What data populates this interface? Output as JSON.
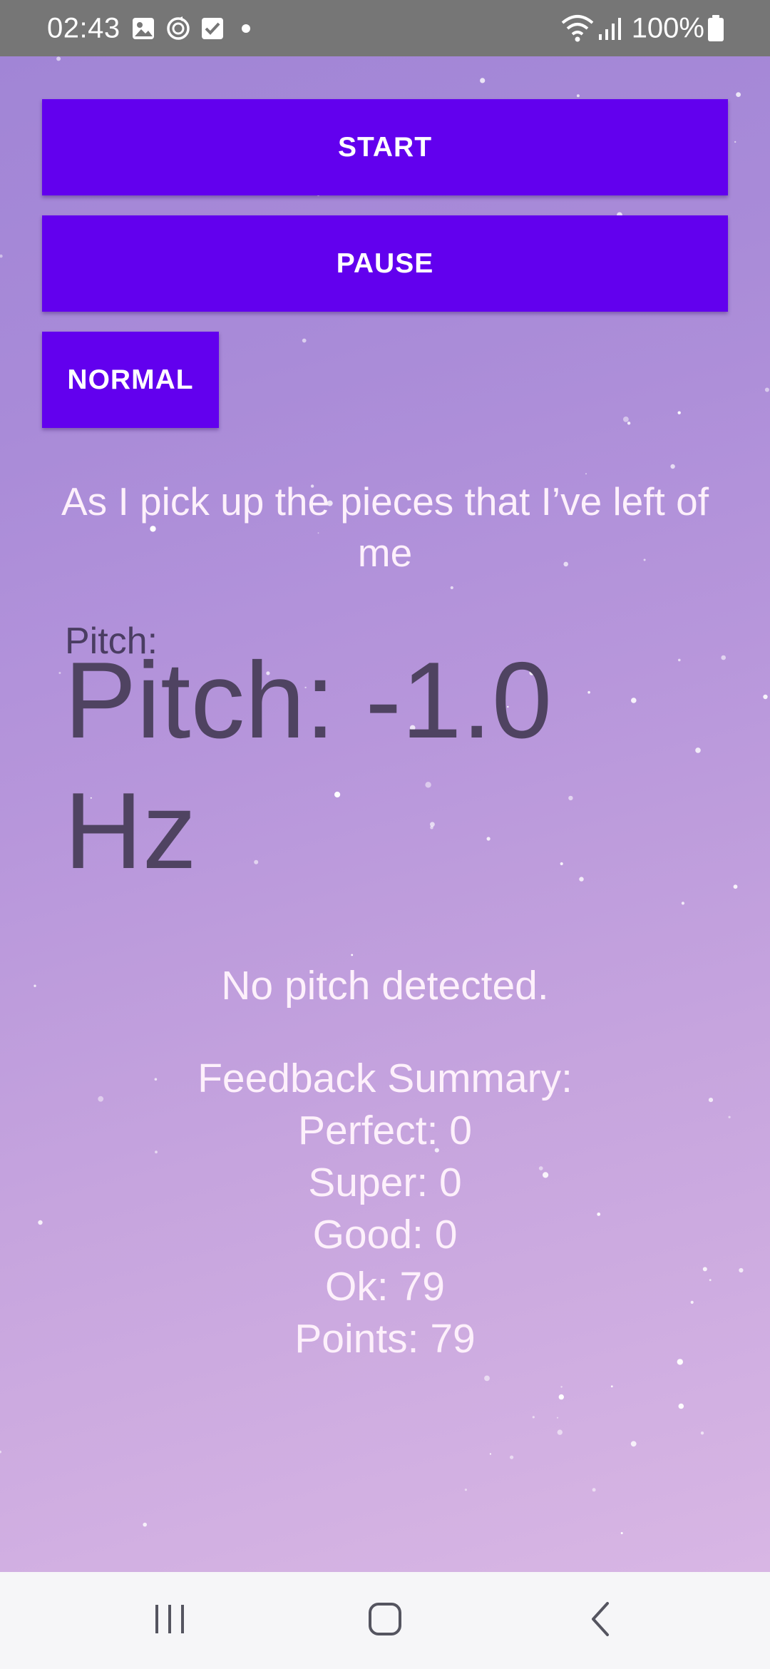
{
  "status_bar": {
    "time": "02:43",
    "battery_text": "100%",
    "icons": [
      "image-icon",
      "sync-icon",
      "checkbox-icon",
      "dot-icon",
      "wifi-icon",
      "signal-icon",
      "battery-icon"
    ]
  },
  "controls": {
    "start_label": "START",
    "pause_label": "PAUSE",
    "normal_label": "NORMAL"
  },
  "lyric": {
    "line": "As I pick up the pieces that I’ve left of me"
  },
  "pitch": {
    "label": "Pitch:",
    "value_text": "Pitch: -1.0 Hz",
    "status": "No pitch detected."
  },
  "feedback": {
    "title": "Feedback Summary:",
    "perfect": "Perfect: 0",
    "super": "Super: 0",
    "good": "Good: 0",
    "ok": "Ok: 79",
    "points": "Points: 79"
  },
  "nav_bar": {
    "icons": [
      "recents-icon",
      "home-icon",
      "back-icon"
    ]
  },
  "colors": {
    "button": "#6200ee",
    "status_bar": "#767676",
    "gradient_top": "#a185d6",
    "gradient_bottom": "#d8b6e4",
    "light_text": "#fdf0fb",
    "dark_text": "#4f4361"
  }
}
